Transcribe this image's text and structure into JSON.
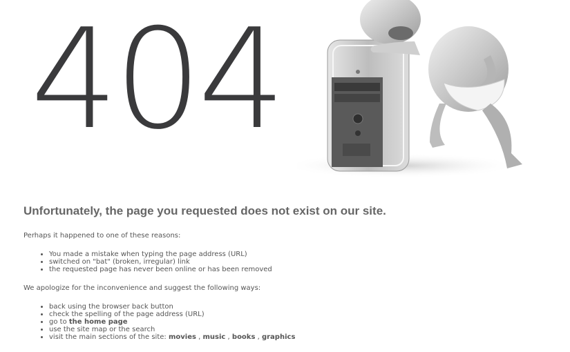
{
  "error_code": "404",
  "heading": "Unfortunately, the page you requested does not exist on our site.",
  "reasons_intro": "Perhaps it happened to one of these reasons:",
  "reasons": [
    "You made a mistake when typing the page address (URL)",
    "switched on \"bat\" (broken, irregular) link",
    "the requested page has never been online or has been removed"
  ],
  "suggest_intro": "We apologize for the inconvenience and suggest the following ways:",
  "suggestions": {
    "back": "back using the browser back button",
    "spelling": "check the spelling of the page address (URL)",
    "home_prefix": "go to ",
    "home_link": "the home page",
    "sitemap": "use the site map or the search",
    "sections_prefix": "visit the main sections of the site: ",
    "sections": [
      "movies",
      "music",
      "books",
      "graphics"
    ],
    "separator": " , "
  }
}
